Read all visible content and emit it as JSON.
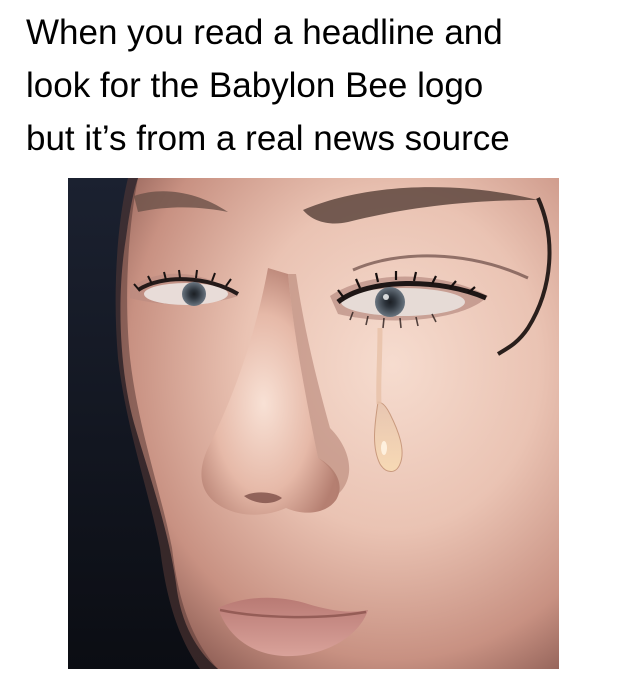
{
  "caption": {
    "lines": [
      "When you read a headline and",
      "look for the Babylon Bee logo",
      "but it’s from a real news source"
    ]
  },
  "photo": {
    "subject": "close-up of a woman's face with a tear running down her cheek",
    "colors": {
      "background": "#12151d",
      "skin_light": "#f2d4c6",
      "skin_mid": "#d9a898",
      "skin_shadow": "#8a5c52",
      "lips": "#c98c86",
      "iris": "#4f5a66",
      "tear": "#f0c9a6"
    }
  }
}
